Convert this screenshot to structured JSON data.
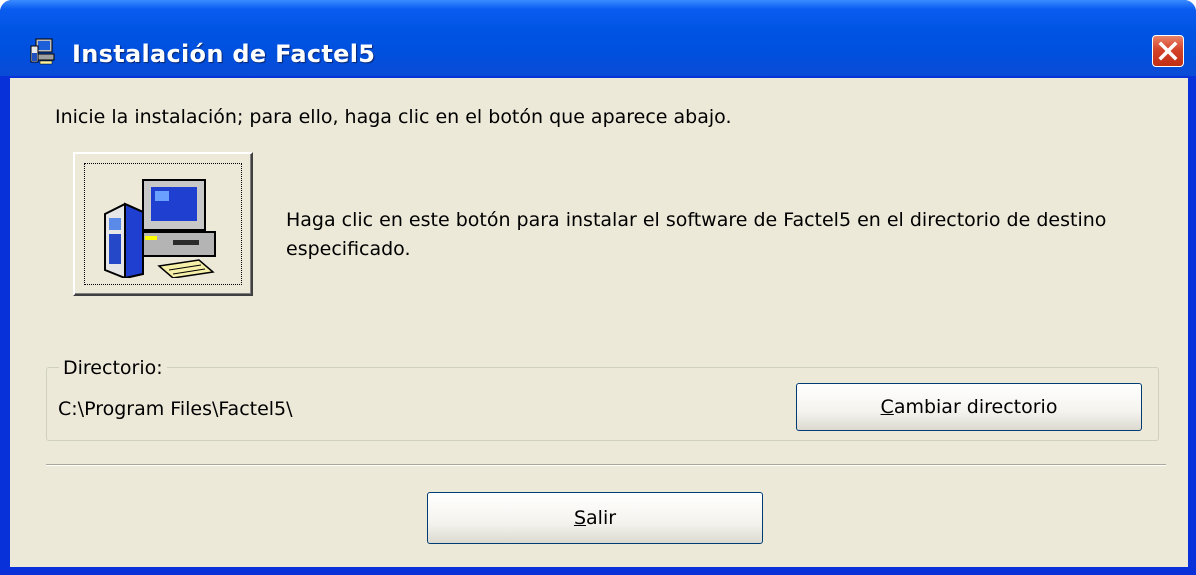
{
  "window": {
    "title": "Instalación de Factel5",
    "title_icon": "installer-computer-icon",
    "close_icon": "close-icon"
  },
  "main": {
    "intro_text": "Inicie la instalación; para ello, haga clic en el botón que aparece abajo.",
    "install_button_icon": "setup-computer-icon",
    "install_description": "Haga clic en este botón para instalar el software de Factel5 en el directorio de destino especificado."
  },
  "directory": {
    "legend": "Directorio:",
    "path": "C:\\Program Files\\Factel5\\",
    "change_button": {
      "accel": "C",
      "rest": "ambiar directorio"
    }
  },
  "footer": {
    "exit_button": {
      "accel": "S",
      "rest": "alir"
    }
  },
  "colors": {
    "titlebar_blue": "#0054e3",
    "frame_blue": "#0831d9",
    "dialog_bg": "#ece9d8",
    "close_red": "#d4432a"
  }
}
